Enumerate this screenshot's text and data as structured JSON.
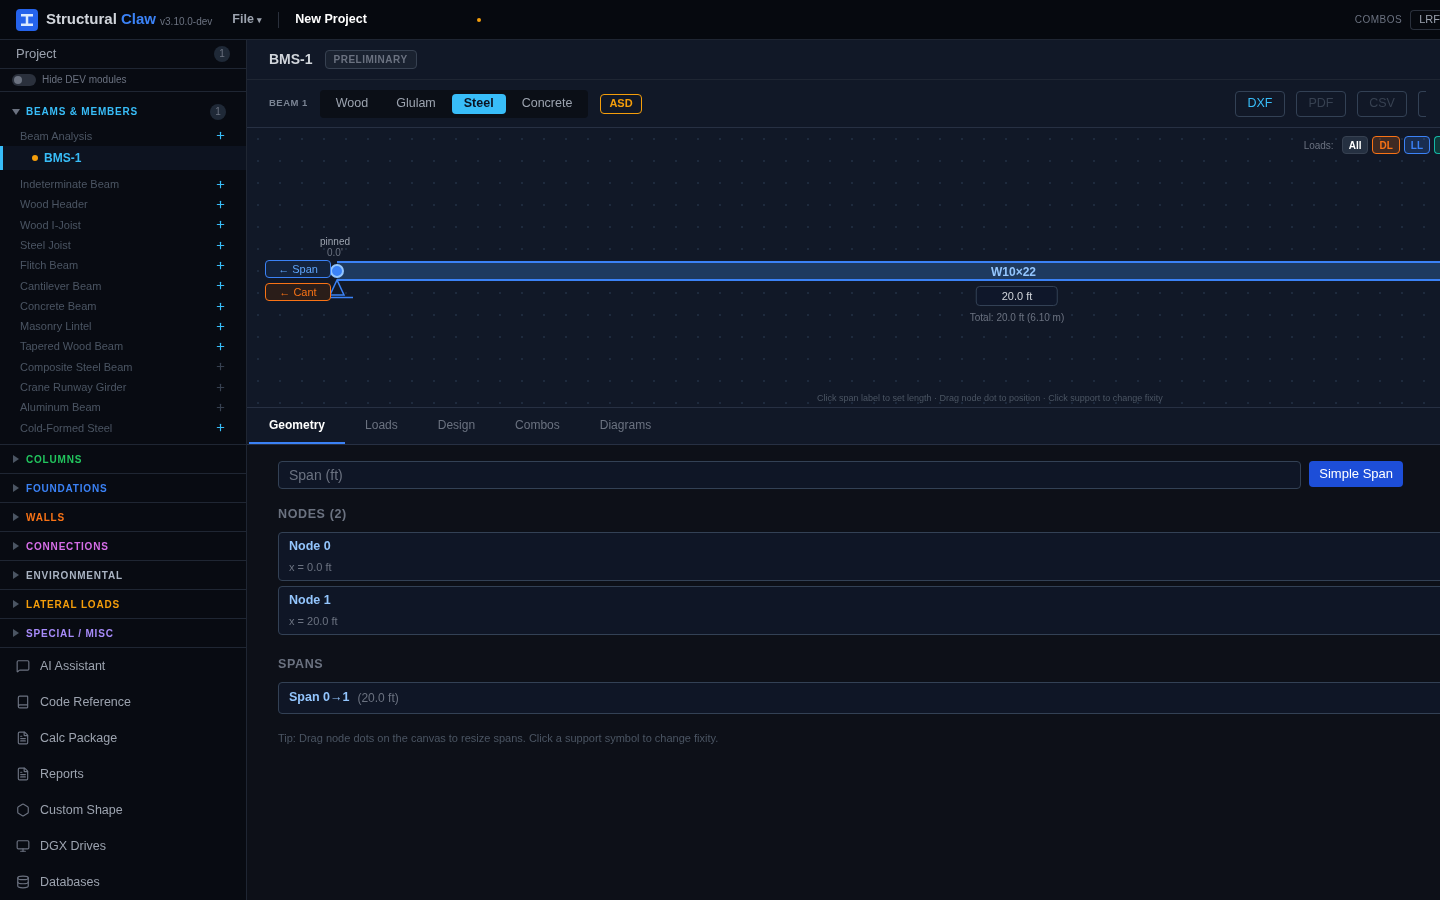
{
  "app": {
    "name": "Structural",
    "name_accent": "Claw",
    "version": "v3.10.0-dev",
    "file_menu": "File",
    "file_caret": "▾",
    "project_title": "New Project",
    "unsaved": true,
    "combos_label": "COMBOS",
    "combos_value": "LRF"
  },
  "sidebar": {
    "project_label": "Project",
    "project_count": "1",
    "hide_dev": {
      "label": "Hide DEV modules",
      "on": false
    },
    "sections": [
      {
        "title": "BEAMS & MEMBERS",
        "color": "#38bdf8",
        "expanded": true,
        "count": "1",
        "children": [
          {
            "label": "Beam Analysis",
            "available": true,
            "children": [
              {
                "label": "BMS-1",
                "selected": true
              }
            ]
          },
          {
            "label": "Indeterminate Beam",
            "available": true
          },
          {
            "label": "Wood Header",
            "available": true
          },
          {
            "label": "Wood I-Joist",
            "available": true
          },
          {
            "label": "Steel Joist",
            "available": true
          },
          {
            "label": "Flitch Beam",
            "available": true
          },
          {
            "label": "Cantilever Beam",
            "available": true
          },
          {
            "label": "Concrete Beam",
            "available": true
          },
          {
            "label": "Masonry Lintel",
            "available": true
          },
          {
            "label": "Tapered Wood Beam",
            "available": true
          },
          {
            "label": "Composite Steel Beam",
            "available": false
          },
          {
            "label": "Crane Runway Girder",
            "available": false
          },
          {
            "label": "Aluminum Beam",
            "available": false
          },
          {
            "label": "Cold-Formed Steel",
            "available": true
          }
        ]
      },
      {
        "title": "COLUMNS",
        "color": "#22c55e",
        "expanded": false
      },
      {
        "title": "FOUNDATIONS",
        "color": "#3b82f6",
        "expanded": false
      },
      {
        "title": "WALLS",
        "color": "#f97316",
        "expanded": false
      },
      {
        "title": "CONNECTIONS",
        "color": "#d66ee8",
        "expanded": false
      },
      {
        "title": "ENVIRONMENTAL",
        "color": "#aab4c3",
        "expanded": false
      },
      {
        "title": "LATERAL LOADS",
        "color": "#f59e0b",
        "expanded": false
      },
      {
        "title": "SPECIAL / MISC",
        "color": "#a78bfa",
        "expanded": false
      }
    ],
    "tools": [
      {
        "kind": "chat",
        "label": "AI Assistant"
      },
      {
        "kind": "book",
        "label": "Code Reference"
      },
      {
        "kind": "file",
        "label": "Calc Package"
      },
      {
        "kind": "file",
        "label": "Reports"
      },
      {
        "kind": "hexagon",
        "label": "Custom Shape"
      },
      {
        "kind": "monitor",
        "label": "DGX Drives"
      },
      {
        "kind": "database",
        "label": "Databases"
      }
    ]
  },
  "header": {
    "title": "BMS-1",
    "status": "PRELIMINARY"
  },
  "toolbar": {
    "beam_label": "BEAM 1",
    "materials": [
      {
        "label": "Wood",
        "selected": false
      },
      {
        "label": "Glulam",
        "selected": false
      },
      {
        "label": "Steel",
        "selected": true
      },
      {
        "label": "Concrete",
        "selected": false
      }
    ],
    "method": "ASD",
    "exports": [
      {
        "label": "DXF",
        "disabled": false
      },
      {
        "label": "PDF",
        "disabled": true
      },
      {
        "label": "CSV",
        "disabled": true
      }
    ]
  },
  "canvas": {
    "loads_label": "Loads:",
    "load_filters": [
      {
        "label": "All",
        "color": "#ffffff",
        "selected": true
      },
      {
        "label": "DL",
        "color": "#f97316",
        "selected": false
      },
      {
        "label": "LL",
        "color": "#3b82f6",
        "selected": false
      }
    ],
    "support": {
      "type": "pinned",
      "position": "0.0'"
    },
    "span_button": "← Span",
    "cant_button": "← Cant",
    "section": "W10×22",
    "span_length": "20.0 ft",
    "total": "Total: 20.0 ft (6.10 m)",
    "hint": "Click span label to set length · Drag node dot to position · Click support to change fixity"
  },
  "tabs": [
    {
      "label": "Geometry",
      "selected": true
    },
    {
      "label": "Loads",
      "selected": false
    },
    {
      "label": "Design",
      "selected": false
    },
    {
      "label": "Combos",
      "selected": false
    },
    {
      "label": "Diagrams",
      "selected": false
    }
  ],
  "geometry": {
    "span_placeholder": "Span (ft)",
    "simple_span": "Simple Span",
    "nodes_heading": "NODES (2)",
    "nodes": [
      {
        "name": "Node 0",
        "position": "x = 0.0 ft"
      },
      {
        "name": "Node 1",
        "position": "x = 20.0 ft"
      }
    ],
    "spans_heading": "SPANS",
    "spans": [
      {
        "name": "Span 0→1",
        "length": "(20.0 ft)"
      }
    ],
    "tip": "Tip: Drag node dots on the canvas to resize spans. Click a support symbol to change fixity."
  }
}
